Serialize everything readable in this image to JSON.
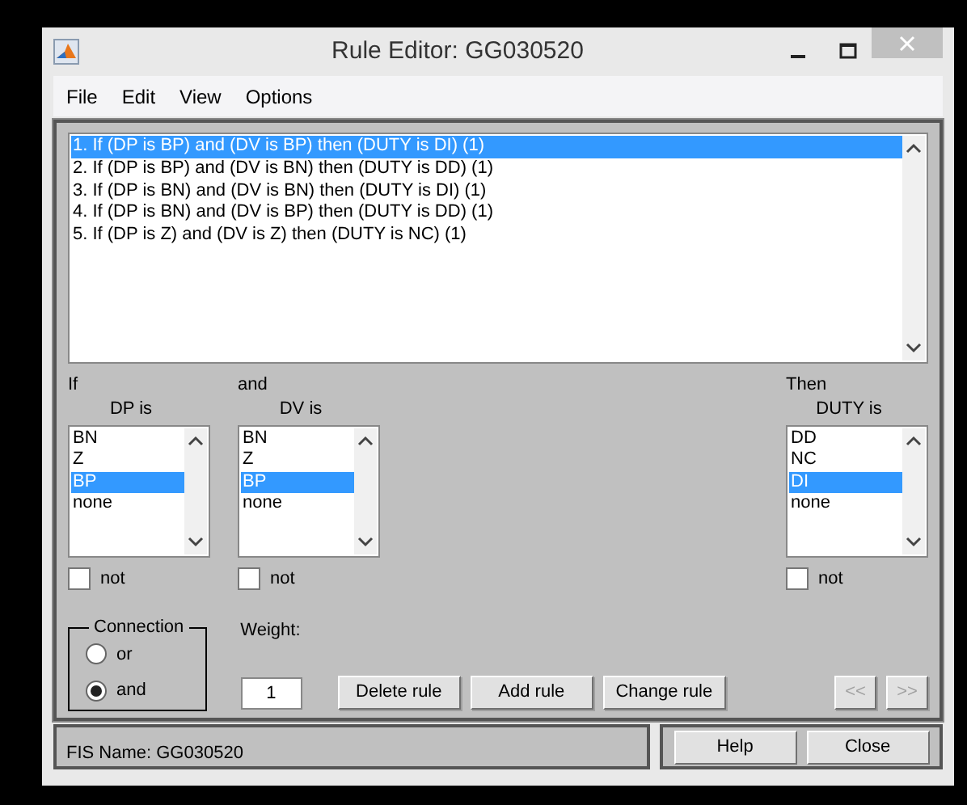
{
  "window": {
    "title": "Rule Editor: GG030520"
  },
  "menu": [
    "File",
    "Edit",
    "View",
    "Options"
  ],
  "rules": [
    {
      "text": "1. If (DP is BP) and (DV is BP) then (DUTY is DI) (1)",
      "selected": true
    },
    {
      "text": "2. If (DP is BP) and (DV is BN) then (DUTY is DD) (1)",
      "selected": false
    },
    {
      "text": "3. If (DP is BN) and (DV is BN) then (DUTY is DI) (1)",
      "selected": false
    },
    {
      "text": "4. If (DP is BN) and (DV is BP) then (DUTY is DD) (1)",
      "selected": false
    },
    {
      "text": "5. If (DP is Z) and (DV is Z) then (DUTY is NC) (1)",
      "selected": false
    }
  ],
  "inputs": [
    {
      "label": "If",
      "heading": "DP is",
      "options": [
        {
          "text": "BN",
          "selected": false
        },
        {
          "text": "Z",
          "selected": false
        },
        {
          "text": "BP",
          "selected": true
        },
        {
          "text": "none",
          "selected": false
        }
      ],
      "not": {
        "label": "not",
        "checked": false
      }
    },
    {
      "label": "and",
      "heading": "DV is",
      "options": [
        {
          "text": "BN",
          "selected": false
        },
        {
          "text": "Z",
          "selected": false
        },
        {
          "text": "BP",
          "selected": true
        },
        {
          "text": "none",
          "selected": false
        }
      ],
      "not": {
        "label": "not",
        "checked": false
      }
    }
  ],
  "output": {
    "label": "Then",
    "heading": "DUTY is",
    "options": [
      {
        "text": "DD",
        "selected": false
      },
      {
        "text": "NC",
        "selected": false
      },
      {
        "text": "DI",
        "selected": true
      },
      {
        "text": "none",
        "selected": false
      }
    ],
    "not": {
      "label": "not",
      "checked": false
    }
  },
  "connection": {
    "title": "Connection",
    "options": [
      {
        "label": "or",
        "selected": false
      },
      {
        "label": "and",
        "selected": true
      }
    ]
  },
  "weight": {
    "label": "Weight:",
    "value": "1"
  },
  "buttons": [
    {
      "label": "Delete rule",
      "disabled": false
    },
    {
      "label": "Add rule",
      "disabled": false
    },
    {
      "label": "Change rule",
      "disabled": false
    }
  ],
  "nav_buttons": [
    {
      "label": "<<",
      "disabled": true
    },
    {
      "label": ">>",
      "disabled": true
    }
  ],
  "status": "FIS Name: GG030520",
  "footer_buttons": [
    "Help",
    "Close"
  ]
}
